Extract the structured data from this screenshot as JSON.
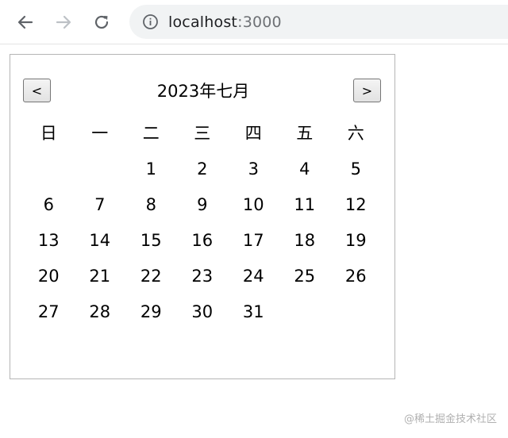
{
  "browser": {
    "url_host": "localhost",
    "url_port": ":3000"
  },
  "calendar": {
    "title": "2023年七月",
    "prev_label": "<",
    "next_label": ">",
    "weekdays": [
      "日",
      "一",
      "二",
      "三",
      "四",
      "五",
      "六"
    ],
    "weeks": [
      [
        "",
        "",
        "1",
        "2",
        "3",
        "4",
        "5"
      ],
      [
        "6",
        "7",
        "8",
        "9",
        "10",
        "11",
        "12"
      ],
      [
        "13",
        "14",
        "15",
        "16",
        "17",
        "18",
        "19"
      ],
      [
        "20",
        "21",
        "22",
        "23",
        "24",
        "25",
        "26"
      ],
      [
        "27",
        "28",
        "29",
        "30",
        "31",
        "",
        ""
      ]
    ]
  },
  "watermark": "@稀土掘金技术社区",
  "icons": {
    "back": "back-arrow-icon",
    "forward": "forward-arrow-icon",
    "reload": "reload-icon",
    "info": "info-icon"
  }
}
